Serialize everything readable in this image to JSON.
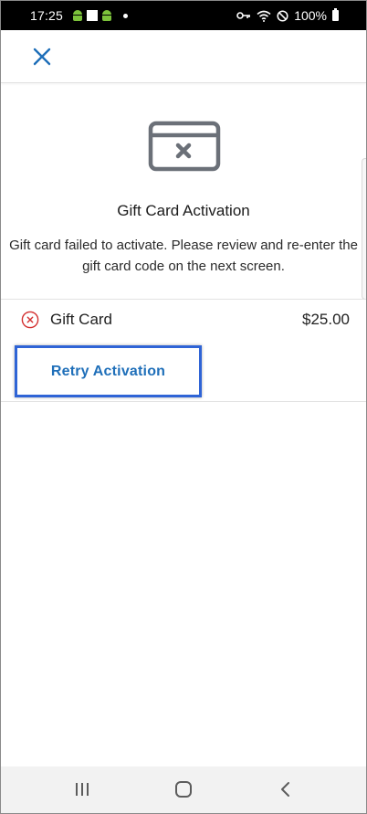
{
  "status_bar": {
    "time": "17:25",
    "battery": "100%"
  },
  "header": {
    "close_icon": "close-icon"
  },
  "main": {
    "title": "Gift Card Activation",
    "description_line1": "Gift card failed to activate. Please review and re-enter the",
    "description_line2": "gift card code on the next screen.",
    "item": {
      "label": "Gift Card",
      "price": "$25.00",
      "status_icon": "error-circle-icon"
    },
    "retry_label": "Retry Activation"
  },
  "colors": {
    "accent": "#1f6fb9",
    "highlight_border": "#2f64d6",
    "error": "#d32f2f",
    "illustration": "#6b7078"
  },
  "nav": {
    "recent_icon": "recent-apps-icon",
    "home_icon": "home-icon",
    "back_icon": "back-icon"
  }
}
